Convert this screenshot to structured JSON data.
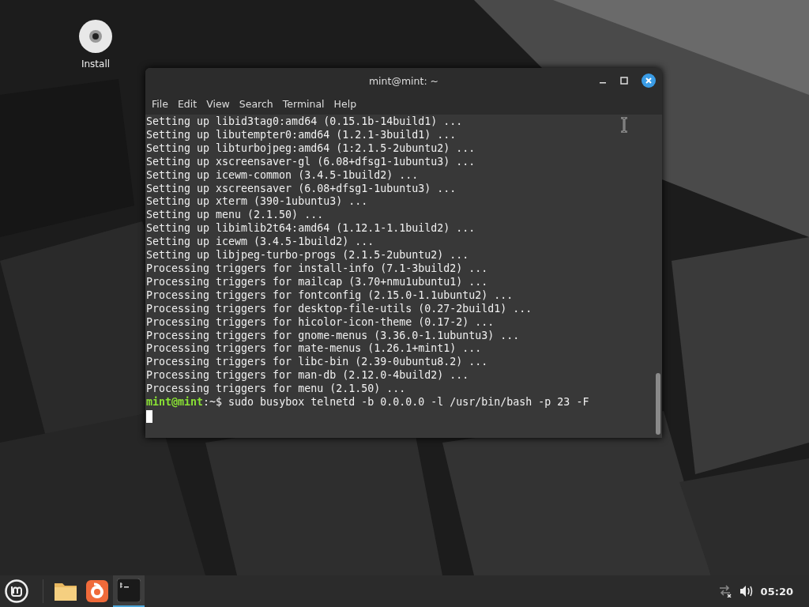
{
  "desktop_icons": [
    {
      "label": "Install"
    }
  ],
  "terminal": {
    "title": "mint@mint: ~",
    "menu": [
      "File",
      "Edit",
      "View",
      "Search",
      "Terminal",
      "Help"
    ],
    "lines": [
      "Setting up libid3tag0:amd64 (0.15.1b-14build1) ...",
      "Setting up libutempter0:amd64 (1.2.1-3build1) ...",
      "Setting up libturbojpeg:amd64 (1:2.1.5-2ubuntu2) ...",
      "Setting up xscreensaver-gl (6.08+dfsg1-1ubuntu3) ...",
      "Setting up icewm-common (3.4.5-1build2) ...",
      "Setting up xscreensaver (6.08+dfsg1-1ubuntu3) ...",
      "Setting up xterm (390-1ubuntu3) ...",
      "Setting up menu (2.1.50) ...",
      "Setting up libimlib2t64:amd64 (1.12.1-1.1build2) ...",
      "Setting up icewm (3.4.5-1build2) ...",
      "Setting up libjpeg-turbo-progs (2.1.5-2ubuntu2) ...",
      "Processing triggers for install-info (7.1-3build2) ...",
      "Processing triggers for mailcap (3.70+nmu1ubuntu1) ...",
      "Processing triggers for fontconfig (2.15.0-1.1ubuntu2) ...",
      "Processing triggers for desktop-file-utils (0.27-2build1) ...",
      "Processing triggers for hicolor-icon-theme (0.17-2) ...",
      "Processing triggers for gnome-menus (3.36.0-1.1ubuntu3) ...",
      "Processing triggers for mate-menus (1.26.1+mint1) ...",
      "Processing triggers for libc-bin (2.39-0ubuntu8.2) ...",
      "Processing triggers for man-db (2.12.0-4build2) ...",
      "Processing triggers for menu (2.1.50) ..."
    ],
    "prompt": {
      "user_host": "mint@mint",
      "rest": ":~$ sudo busybox telnetd -b 0.0.0.0 -l /usr/bin/bash -p 23 -F"
    }
  },
  "taskbar": {
    "apps": [
      {
        "kind": "files",
        "selected": false
      },
      {
        "kind": "browser",
        "selected": false
      },
      {
        "kind": "terminal",
        "selected": true
      }
    ],
    "clock": "05:20"
  }
}
